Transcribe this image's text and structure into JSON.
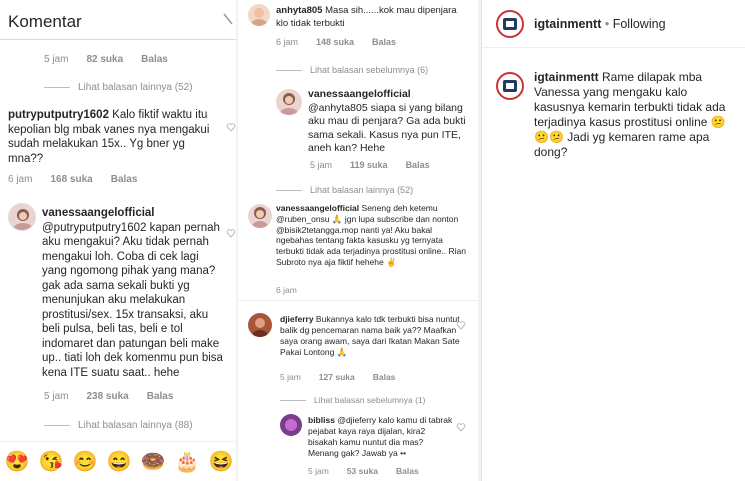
{
  "panel1": {
    "title": "Komentar",
    "top_meta": {
      "time": "5 jam",
      "likes": "82 suka",
      "reply": "Balas"
    },
    "more_replies_1": "Lihat balasan lainnya (52)",
    "comment1": {
      "user": "putryputputry1602",
      "text": "Kalo fiktif waktu itu kepolian blg mbak vanes nya mengakui sudah melakukan 15x.. Yg bner yg mna??",
      "time": "6 jam",
      "likes": "168 suka",
      "reply": "Balas"
    },
    "comment2": {
      "user": "vanessaangelofficial",
      "text": "@putryputputry1602 kapan pernah aku mengakui? Aku tidak pernah mengakui loh. Coba di cek lagi yang ngomong pihak yang mana? gak ada sama sekali bukti yg menunjukan aku melakukan prostitusi/sex. 15x transaksi, aku beli pulsa, beli tas, beli e tol indomaret dan patungan beli make up.. tiati loh dek komenmu pun bisa kena ITE suatu saat.. hehe",
      "time": "5 jam",
      "likes": "238 suka",
      "reply": "Balas"
    },
    "more_replies_2": "Lihat balasan lainnya (88)",
    "emojis": [
      "😍",
      "😘",
      "😊",
      "😄",
      "🍩",
      "🎂",
      "😆"
    ]
  },
  "panel2": {
    "comment1": {
      "user": "anhyta805",
      "text": "Masa sih......kok mau dipenjara klo tidak terbukti",
      "time": "6 jam",
      "likes": "148 suka",
      "reply": "Balas"
    },
    "prev_replies": "Lihat balasan sebelumnya (6)",
    "comment2": {
      "user": "vanessaangelofficial",
      "text": "@anhyta805 siapa si yang bilang aku mau di penjara? Ga ada bukti sama sekali. Kasus nya pun ITE, aneh kan? Hehe",
      "time": "5 jam",
      "likes": "119 suka",
      "reply": "Balas"
    },
    "more_replies": "Lihat balasan lainnya (52)",
    "comment3": {
      "user": "vanessaangelofficial",
      "text": "Seneng deh ketemu @ruben_onsu 🙏 jgn lupa subscribe dan nonton @bisik2tetangga.mop nanti ya! Aku bakal ngebahas tentang fakta kasusku yg ternyata terbukti tidak ada terjadinya prostitusi online.. Rian Subroto nya aja fiktif hehehe ✌",
      "time": "6 jam"
    },
    "comment4": {
      "user": "djieferry",
      "text": "Bukannya kalo tdk terbukti bisa nuntut balik dg pencemaran nama baik ya?? Maafkan saya orang awam, saya dari Ikatan Makan Sate Pakai Lontong 🙏",
      "time": "5 jam",
      "likes": "127 suka",
      "reply": "Balas"
    },
    "prev_replies2": "Lihat balasan sebelumnya (1)",
    "comment5": {
      "user": "bibliss",
      "text": "@djieferry kalo kamu di tabrak pejabat kaya raya dijalan, kira2 bisakah kamu nuntut dia mas? Menang gak? Jawab ya ••",
      "time": "5 jam",
      "likes": "53 suka",
      "reply": "Balas"
    }
  },
  "panel3": {
    "header": {
      "user": "igtainmentt",
      "dot": "•",
      "follow": "Following"
    },
    "caption": {
      "user": "igtainmentt",
      "text": "Rame dilapak mba Vanessa yang mengaku kalo kasusnya kemarin terbukti tidak ada terjadinya kasus prostitusi online 😕😕😕 Jadi yg kemaren rame apa dong?"
    }
  },
  "colors": {
    "muted": "#8e8e8e",
    "text": "#262626",
    "border": "#efefef"
  }
}
